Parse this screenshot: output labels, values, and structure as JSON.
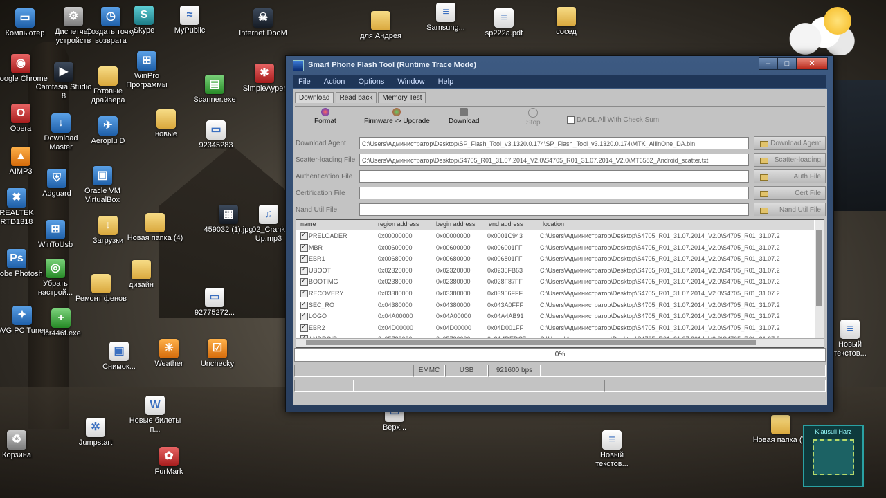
{
  "desktop_icons": [
    {
      "label": "Компьютер",
      "icon": "computer-icon"
    },
    {
      "label": "Диспетчер устройств",
      "icon": "device-manager-icon"
    },
    {
      "label": "Создать точку возврата",
      "icon": "restore-point-icon"
    },
    {
      "label": "Skype",
      "icon": "skype-icon"
    },
    {
      "label": "MyPublic",
      "icon": "wifi-icon"
    },
    {
      "label": "Internet DooM",
      "icon": "internet-doom-icon"
    },
    {
      "label": "для Андрея",
      "icon": "folder-icon"
    },
    {
      "label": "Samsung...",
      "icon": "document-icon"
    },
    {
      "label": "sp222a.pdf",
      "icon": "pdf-icon"
    },
    {
      "label": "сосед",
      "icon": "folder-icon"
    },
    {
      "label": "Google Chrome",
      "icon": "chrome-icon"
    },
    {
      "label": "Camtasia Studio 8",
      "icon": "camtasia-icon"
    },
    {
      "label": "Готовые драйвера",
      "icon": "folder-icon"
    },
    {
      "label": "WinPro Программы",
      "icon": "winpro-icon"
    },
    {
      "label": "Scanner.exe",
      "icon": "scanner-icon"
    },
    {
      "label": "SimpleAyper",
      "icon": "simpleayper-icon"
    },
    {
      "label": "Opera",
      "icon": "opera-icon"
    },
    {
      "label": "Download Master",
      "icon": "download-master-icon"
    },
    {
      "label": "Aeroplu D",
      "icon": "aeroplu-icon"
    },
    {
      "label": "новые",
      "icon": "folder-icon"
    },
    {
      "label": "92345283",
      "icon": "file-icon"
    },
    {
      "label": "AIMP3",
      "icon": "aimp-icon"
    },
    {
      "label": "Adguard",
      "icon": "adguard-icon"
    },
    {
      "label": "Oracle VM VirtualBox",
      "icon": "virtualbox-icon"
    },
    {
      "label": "REALTEK RTD1318",
      "icon": "realtek-icon"
    },
    {
      "label": "WinToUsb",
      "icon": "wintousb-icon"
    },
    {
      "label": "Загрузки",
      "icon": "downloads-folder-icon"
    },
    {
      "label": "Новая папка (4)",
      "icon": "folder-icon"
    },
    {
      "label": "459032 (1).jpg",
      "icon": "image-icon"
    },
    {
      "label": "02_Crank Up.mp3",
      "icon": "mp3-icon"
    },
    {
      "label": "Adobe Photosh",
      "icon": "photoshop-icon"
    },
    {
      "label": "Убрать настрой...",
      "icon": "nvidia-icon"
    },
    {
      "label": "Ремонт фенов",
      "icon": "folder-icon"
    },
    {
      "label": "дизайн",
      "icon": "folder-icon"
    },
    {
      "label": "92775272...",
      "icon": "file-icon"
    },
    {
      "label": "AVG PC Tuneu",
      "icon": "avg-icon"
    },
    {
      "label": "ucr446f.exe",
      "icon": "exe-icon"
    },
    {
      "label": "Снимок...",
      "icon": "screenshot-icon"
    },
    {
      "label": "Weather",
      "icon": "weather-icon"
    },
    {
      "label": "Unchecky",
      "icon": "unchecky-icon"
    },
    {
      "label": "Новые билеты п...",
      "icon": "word-doc-icon"
    },
    {
      "label": "Корзина",
      "icon": "recycle-bin-icon"
    },
    {
      "label": "Jumpstart",
      "icon": "jumpstart-icon"
    },
    {
      "label": "FurMark",
      "icon": "furmark-icon"
    },
    {
      "label": "Верх...",
      "icon": "file-icon"
    },
    {
      "label": "Новая папка (7)",
      "icon": "folder-icon"
    },
    {
      "label": "Новый текстов...",
      "icon": "text-file-icon"
    },
    {
      "label": "Новый текстов...",
      "icon": "text-file-icon"
    }
  ],
  "gadget": {
    "title": "Klausuli Harz"
  },
  "window": {
    "title": "Smart Phone Flash Tool (Runtime Trace Mode)",
    "menu": [
      "File",
      "Action",
      "Options",
      "Window",
      "Help"
    ],
    "tabs": [
      "Download",
      "Read back",
      "Memory Test"
    ],
    "toolbar": {
      "format": "Format",
      "firmware_upgrade": "Firmware -> Upgrade",
      "download": "Download",
      "stop": "Stop",
      "da_checksum": "DA DL All With Check Sum"
    },
    "fields": {
      "download_agent": {
        "label": "Download Agent",
        "value": "C:\\Users\\Администратор\\Desktop\\SP_Flash_Tool_v3.1320.0.174\\SP_Flash_Tool_v3.1320.0.174\\MTK_AllInOne_DA.bin",
        "button": "Download Agent"
      },
      "scatter": {
        "label": "Scatter-loading File",
        "value": "C:\\Users\\Администратор\\Desktop\\S4705_R01_31.07.2014_V2.0\\S4705_R01_31.07.2014_V2.0\\MT6582_Android_scatter.txt",
        "button": "Scatter-loading"
      },
      "auth": {
        "label": "Authentication File",
        "value": "",
        "button": "Auth File"
      },
      "cert": {
        "label": "Certification File",
        "value": "",
        "button": "Cert File"
      },
      "nand": {
        "label": "Nand Util File",
        "value": "",
        "button": "Nand Util File"
      }
    },
    "table": {
      "columns": [
        "name",
        "region address",
        "begin address",
        "end address",
        "location"
      ],
      "rows": [
        {
          "name": "PRELOADER",
          "region": "0x00000000",
          "begin": "0x00000000",
          "end": "0x0001C943",
          "location": "C:\\Users\\Администратор\\Desktop\\S4705_R01_31.07.2014_V2.0\\S4705_R01_31.07.2"
        },
        {
          "name": "MBR",
          "region": "0x00600000",
          "begin": "0x00600000",
          "end": "0x006001FF",
          "location": "C:\\Users\\Администратор\\Desktop\\S4705_R01_31.07.2014_V2.0\\S4705_R01_31.07.2"
        },
        {
          "name": "EBR1",
          "region": "0x00680000",
          "begin": "0x00680000",
          "end": "0x006801FF",
          "location": "C:\\Users\\Администратор\\Desktop\\S4705_R01_31.07.2014_V2.0\\S4705_R01_31.07.2"
        },
        {
          "name": "UBOOT",
          "region": "0x02320000",
          "begin": "0x02320000",
          "end": "0x0235FB63",
          "location": "C:\\Users\\Администратор\\Desktop\\S4705_R01_31.07.2014_V2.0\\S4705_R01_31.07.2"
        },
        {
          "name": "BOOTIMG",
          "region": "0x02380000",
          "begin": "0x02380000",
          "end": "0x028F87FF",
          "location": "C:\\Users\\Администратор\\Desktop\\S4705_R01_31.07.2014_V2.0\\S4705_R01_31.07.2"
        },
        {
          "name": "RECOVERY",
          "region": "0x03380000",
          "begin": "0x03380000",
          "end": "0x03956FFF",
          "location": "C:\\Users\\Администратор\\Desktop\\S4705_R01_31.07.2014_V2.0\\S4705_R01_31.07.2"
        },
        {
          "name": "SEC_RO",
          "region": "0x04380000",
          "begin": "0x04380000",
          "end": "0x043A0FFF",
          "location": "C:\\Users\\Администратор\\Desktop\\S4705_R01_31.07.2014_V2.0\\S4705_R01_31.07.2"
        },
        {
          "name": "LOGO",
          "region": "0x04A00000",
          "begin": "0x04A00000",
          "end": "0x04A4AB91",
          "location": "C:\\Users\\Администратор\\Desktop\\S4705_R01_31.07.2014_V2.0\\S4705_R01_31.07.2"
        },
        {
          "name": "EBR2",
          "region": "0x04D00000",
          "begin": "0x04D00000",
          "end": "0x04D001FF",
          "location": "C:\\Users\\Администратор\\Desktop\\S4705_R01_31.07.2014_V2.0\\S4705_R01_31.07.2"
        },
        {
          "name": "ANDROID",
          "region": "0x05780000",
          "begin": "0x05780000",
          "end": "0x2A4DEDC7",
          "location": "C:\\Users\\Администратор\\Desktop\\S4705_R01_31.07.2014_V2.0\\S4705_R01_31.07.2"
        }
      ]
    },
    "progress": {
      "text": "0%",
      "value": 0
    },
    "status": {
      "storage": "EMMC",
      "port": "USB",
      "baud": "921600 bps"
    }
  },
  "colors": {
    "titlebar": "#3d5a82",
    "menubar": "#1f3658",
    "client": "#c3c3c3"
  }
}
